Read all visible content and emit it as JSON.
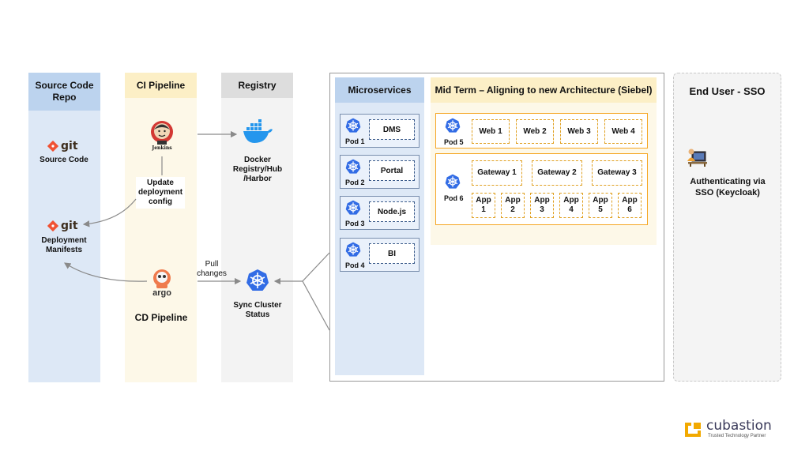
{
  "columns": {
    "source": {
      "title": "Source Code Repo",
      "source_label": "Source Code",
      "manifests_label": "Deployment Manifests",
      "git_word": "git"
    },
    "ci": {
      "title": "CI Pipeline",
      "jenkins_caption": "Jenkins",
      "update_label": "Update deployment config",
      "cd_label": "CD Pipeline",
      "argo_word": "argo"
    },
    "registry": {
      "title": "Registry",
      "docker_label": "Docker Registry/Hub /Harbor",
      "sync_label": "Sync Cluster Status",
      "pull_label": "Pull changes"
    }
  },
  "microservices": {
    "title": "Microservices",
    "pods": [
      {
        "name": "Pod 1",
        "service": "DMS"
      },
      {
        "name": "Pod 2",
        "service": "Portal"
      },
      {
        "name": "Pod 3",
        "service": "Node.js"
      },
      {
        "name": "Pod 4",
        "service": "BI"
      }
    ]
  },
  "midterm": {
    "title": "Mid Term – Aligning to new Architecture (Siebel)",
    "pod5": {
      "name": "Pod 5",
      "webs": [
        "Web 1",
        "Web 2",
        "Web 3",
        "Web 4"
      ]
    },
    "pod6": {
      "name": "Pod 6",
      "gateways": [
        "Gateway 1",
        "Gateway 2",
        "Gateway 3"
      ],
      "apps": [
        [
          "App",
          "1"
        ],
        [
          "App",
          "2"
        ],
        [
          "App",
          "3"
        ],
        [
          "App",
          "4"
        ],
        [
          "App",
          "5"
        ],
        [
          "App",
          "6"
        ]
      ]
    }
  },
  "enduser": {
    "title": "End User - SSO",
    "auth_label": "Authenticating via SSO (Keycloak)"
  },
  "brand": {
    "name": "cubastion",
    "tagline": "Trusted Technology Partner"
  },
  "colors": {
    "source_col": "#dde8f6",
    "source_head": "#bcd3ee",
    "ci_col": "#fdf8e8",
    "ci_head": "#fcefc6",
    "registry_col": "#f3f3f3",
    "registry_head": "#dddddd",
    "k8s_blue": "#326ce5",
    "docker_blue": "#2496ed",
    "orange": "#f5a623",
    "git_orange": "#f05133"
  }
}
